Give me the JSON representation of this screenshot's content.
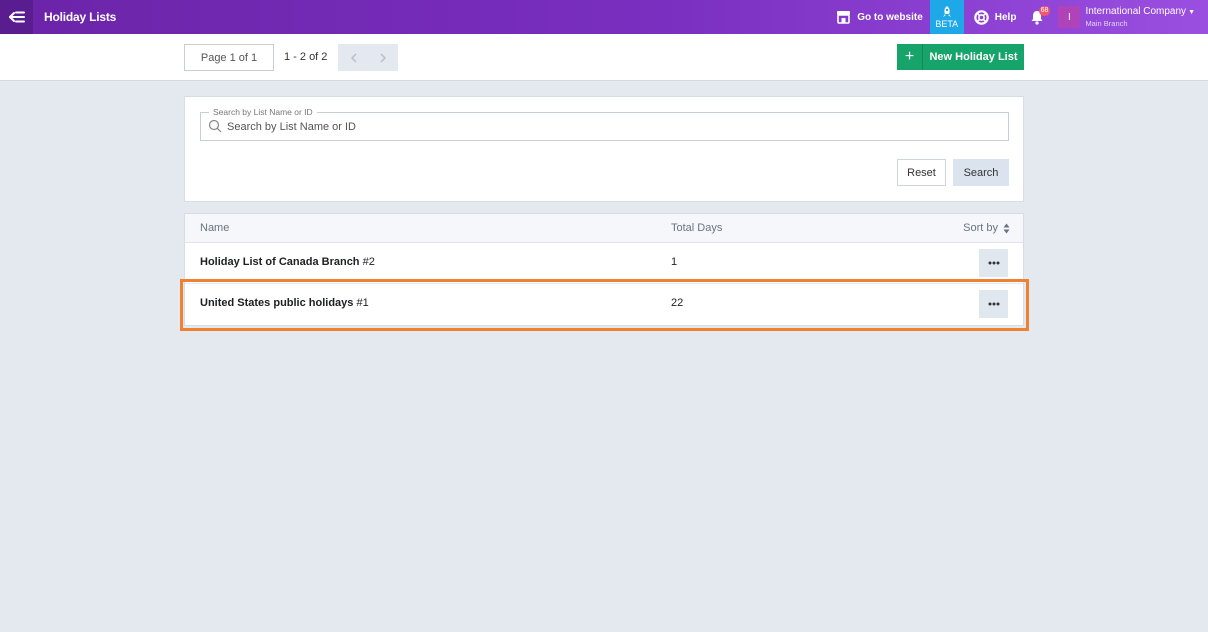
{
  "header": {
    "title": "Holiday Lists",
    "goto_website": "Go to website",
    "beta": "BETA",
    "help": "Help",
    "notification_count": "68",
    "account": {
      "initial": "I",
      "name": "International Company",
      "branch": "Main Branch"
    }
  },
  "toolbar": {
    "pager_label": "Page 1 of 1",
    "range_label": "1 - 2 of 2",
    "new_button_label": "New Holiday List",
    "new_button_icon": "+"
  },
  "search": {
    "legend": "Search by List Name or ID",
    "placeholder": "Search by List Name or ID",
    "reset_label": "Reset",
    "search_label": "Search"
  },
  "table": {
    "columns": {
      "name": "Name",
      "total_days": "Total Days",
      "sort_by": "Sort by"
    },
    "rows": [
      {
        "name": "Holiday List of Canada Branch",
        "id": "#2",
        "total_days": "1"
      },
      {
        "name": "United States public holidays",
        "id": "#1",
        "total_days": "22"
      }
    ]
  },
  "colors": {
    "header_gradient_start": "#6b24a8",
    "header_gradient_end": "#9a4fe0",
    "beta_bg": "#1fa8e8",
    "primary_green": "#17a46a",
    "highlight_orange": "#ee8132"
  }
}
